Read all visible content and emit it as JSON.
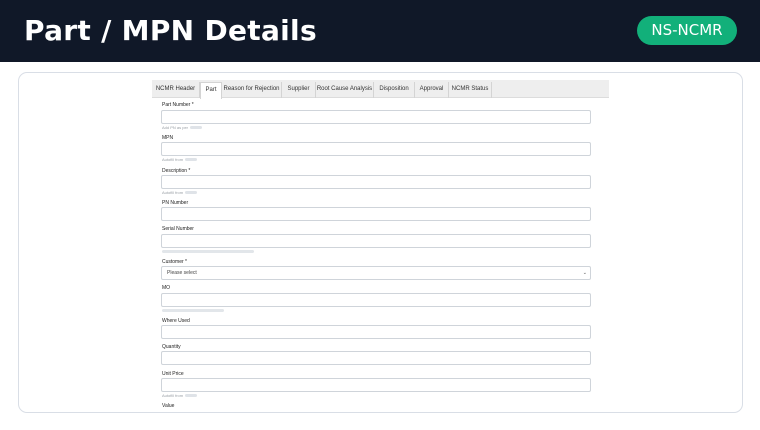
{
  "header": {
    "title": "Part / MPN Details",
    "badge": "NS-NCMR"
  },
  "tabs": [
    {
      "label": "NCMR Header",
      "active": false
    },
    {
      "label": "Part",
      "active": true
    },
    {
      "label": "Reason for Rejection",
      "active": false
    },
    {
      "label": "Supplier",
      "active": false
    },
    {
      "label": "Root Cause Analysis",
      "active": false
    },
    {
      "label": "Disposition",
      "active": false
    },
    {
      "label": "Approval",
      "active": false
    },
    {
      "label": "NCMR Status",
      "active": false
    }
  ],
  "form": {
    "part_number": {
      "label": "Part Number *",
      "value": "",
      "hint": "Add PN as per"
    },
    "mpn": {
      "label": "MPN",
      "value": "",
      "hint": "Autofill from"
    },
    "description": {
      "label": "Description *",
      "value": "",
      "hint": "Autofill from"
    },
    "pn_number": {
      "label": "PN Number",
      "value": ""
    },
    "serial_number": {
      "label": "Serial Number",
      "value": ""
    },
    "customer": {
      "label": "Customer *",
      "selected": "Please select"
    },
    "mo": {
      "label": "MO",
      "value": ""
    },
    "where_used": {
      "label": "Where Used",
      "value": ""
    },
    "quantity": {
      "label": "Quantity",
      "value": ""
    },
    "unit_price": {
      "label": "Unit Price",
      "value": "",
      "hint": "Autofill from"
    },
    "value": {
      "label": "Value"
    }
  },
  "colors": {
    "header_bg": "#101828",
    "badge_bg": "#12b07a",
    "tab_bar_bg": "#eeeeee",
    "input_border": "#cfd4da"
  },
  "icons": {
    "select_chevron": "chevron-down-icon"
  }
}
